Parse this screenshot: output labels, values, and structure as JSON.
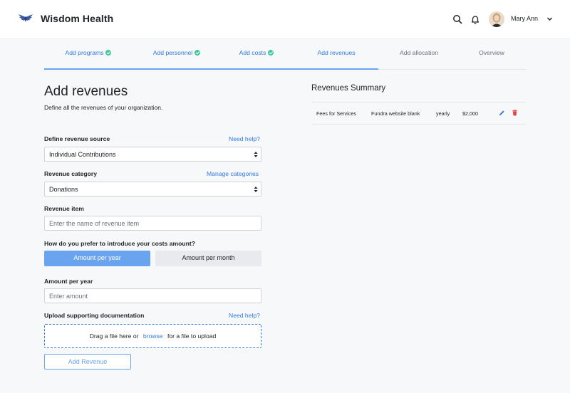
{
  "header": {
    "brand": "Wisdom Health",
    "user_name": "Mary Ann",
    "icons": [
      "wings-logo-icon",
      "search-icon",
      "bell-icon",
      "chevron-down-icon"
    ]
  },
  "steps": [
    {
      "label": "Add programs",
      "done": true
    },
    {
      "label": "Add personnel",
      "done": true
    },
    {
      "label": "Add costs",
      "done": true
    },
    {
      "label": "Add revenues",
      "done": false,
      "current": true
    },
    {
      "label": "Add allocation",
      "done": false
    },
    {
      "label": "Overview",
      "done": false
    }
  ],
  "page": {
    "title": "Add revenues",
    "subtitle": "Define all the revenues of your organization."
  },
  "form": {
    "source_label": "Define revenue source",
    "source_help": "Need help?",
    "source_value": "Individual Contributions",
    "category_label": "Revenue category",
    "category_link": "Manage categories",
    "category_value": "Donations",
    "item_label": "Revenue item",
    "item_placeholder": "Enter the name of revenue item",
    "amount_question": "How do you prefer to introduce your costs amount?",
    "toggle_year": "Amount per year",
    "toggle_month": "Amount per month",
    "toggle_selected": "Amount per year",
    "amount_label": "Amount per year",
    "amount_placeholder": "Enter amount",
    "upload_label": "Upload supporting documentation",
    "upload_help": "Need help?",
    "drop_text_before": "Drag a file here or",
    "drop_browse": "browse",
    "drop_text_after": "for a file to upload",
    "submit_label": "Add Revenue"
  },
  "summary": {
    "title": "Revenues Summary",
    "rows": [
      {
        "source": "Fees for Services",
        "item": "Fundra website blank",
        "period": "yearly",
        "amount": "$2,000"
      }
    ]
  },
  "colors": {
    "accent": "#2f7ae5",
    "accent_light": "#6aa4ee",
    "success": "#3fc89a",
    "danger": "#e53e3e"
  }
}
